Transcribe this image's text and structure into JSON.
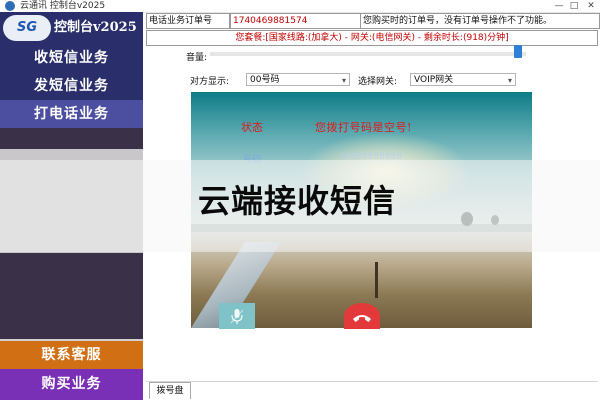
{
  "window": {
    "title": "云通讯 控制台v2025",
    "minimize": "—",
    "maximize": "□",
    "close": "✕"
  },
  "sidebar": {
    "logo_badge": "SG",
    "logo_name": "控制台v2025",
    "items": [
      {
        "label": "收短信业务"
      },
      {
        "label": "发短信业务"
      },
      {
        "label": "打电话业务",
        "active": true
      }
    ],
    "contact_label": "联系客服",
    "buy_label": "购买业务"
  },
  "info": {
    "order_label": "电话业务订单号",
    "order_value": "1740469881574",
    "order_hint": "您购买时的订单号，没有订单号操作不了功能。",
    "plan_text": "您套餐:[国家线路:(加拿大) - 网关:(电信网关) - 剩余时长:(918)分钟]"
  },
  "controls": {
    "volume_label": "音量:",
    "volume_level": 0.97,
    "display_label": "对方显示:",
    "display_value": "00号码",
    "gateway_label": "选择网关:",
    "gateway_value": "VOIP网关"
  },
  "call": {
    "status_label": "状态",
    "status_message": "您拨打号码是空号!",
    "number_label": "号码",
    "number_value": "18888888888"
  },
  "overlay": {
    "title": "云端接收短信"
  },
  "tabs": {
    "dial_pad": "拨号盘"
  },
  "colors": {
    "sidebar_bg": "#2a2f6b",
    "sidebar_active": "#4c4fa0",
    "contact_bg": "#d06f14",
    "buy_bg": "#7a2fb7",
    "status_red": "#e01818",
    "hangup_red": "#e23a3a",
    "mic_teal": "#7fc2c7"
  },
  "icons": [
    "app-icon",
    "microphone-icon",
    "phone-hangup-icon",
    "chevron-down-icon"
  ]
}
